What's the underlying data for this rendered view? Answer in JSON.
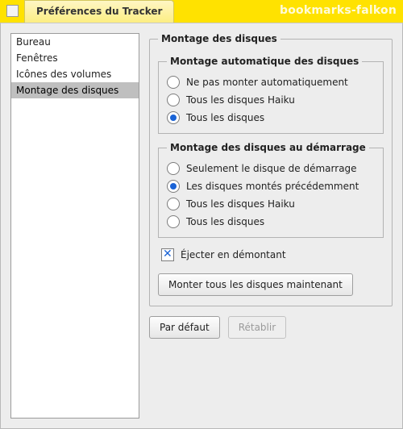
{
  "titlebar": {
    "window_title": "Préférences du Tracker",
    "background_tab": "bookmarks-falkon"
  },
  "sidebar": {
    "items": [
      {
        "label": "Bureau",
        "selected": false
      },
      {
        "label": "Fenêtres",
        "selected": false
      },
      {
        "label": "Icônes des volumes",
        "selected": false
      },
      {
        "label": "Montage des disques",
        "selected": true
      }
    ]
  },
  "panel": {
    "title": "Montage des disques",
    "auto": {
      "legend": "Montage automatique des disques",
      "options": [
        {
          "label": "Ne pas monter automatiquement",
          "checked": false
        },
        {
          "label": "Tous les disques Haiku",
          "checked": false
        },
        {
          "label": "Tous les disques",
          "checked": true
        }
      ]
    },
    "boot": {
      "legend": "Montage des disques au démarrage",
      "options": [
        {
          "label": "Seulement le disque de démarrage",
          "checked": false
        },
        {
          "label": "Les disques montés précédemment",
          "checked": true
        },
        {
          "label": "Tous les disques Haiku",
          "checked": false
        },
        {
          "label": "Tous les disques",
          "checked": false
        }
      ]
    },
    "eject_label": "Éjecter en démontant",
    "eject_checked": true,
    "mount_now_button": "Monter tous les disques maintenant"
  },
  "footer": {
    "defaults_button": "Par défaut",
    "revert_button": "Rétablir",
    "revert_enabled": false
  }
}
